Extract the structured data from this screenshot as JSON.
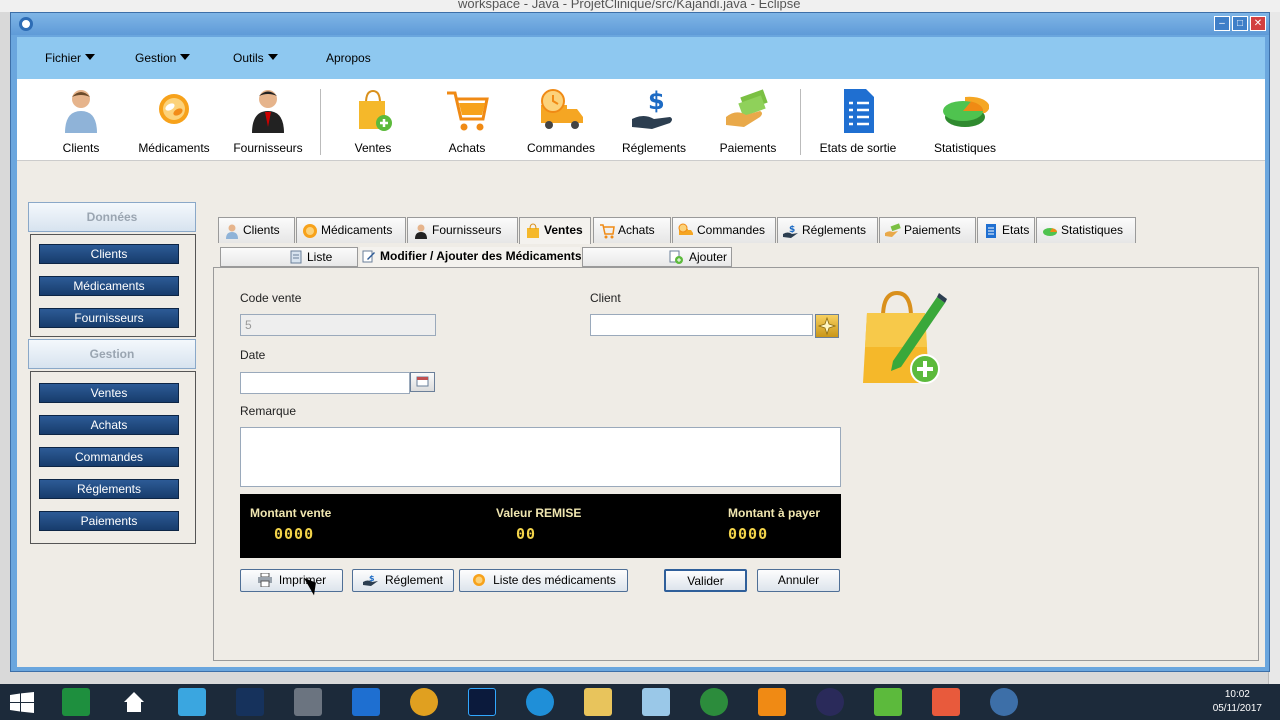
{
  "background": {
    "eclipse_title": "workspace - Java - ProjetClinique/src/Kajandi.java - Eclipse"
  },
  "menubar": {
    "items": [
      "Fichier",
      "Gestion",
      "Outils",
      "Apropos"
    ]
  },
  "toolbar": {
    "items": [
      {
        "label": "Clients",
        "icon": "client-person-icon"
      },
      {
        "label": "Médicaments",
        "icon": "medicine-icon"
      },
      {
        "label": "Fournisseurs",
        "icon": "supplier-person-icon"
      },
      {
        "label": "Ventes",
        "icon": "shopping-bag-icon"
      },
      {
        "label": "Achats",
        "icon": "cart-icon"
      },
      {
        "label": "Commandes",
        "icon": "delivery-truck-icon"
      },
      {
        "label": "Réglements",
        "icon": "dollar-hand-icon"
      },
      {
        "label": "Paiements",
        "icon": "money-hand-icon"
      },
      {
        "label": "Etats de sortie",
        "icon": "document-list-icon"
      },
      {
        "label": "Statistiques",
        "icon": "pie-chart-icon"
      }
    ]
  },
  "sidebar": {
    "sections": [
      {
        "title": "Données",
        "items": [
          "Clients",
          "Médicaments",
          "Fournisseurs"
        ]
      },
      {
        "title": "Gestion",
        "items": [
          "Ventes",
          "Achats",
          "Commandes",
          "Réglements",
          "Paiements"
        ]
      }
    ]
  },
  "tabs": [
    "Clients",
    "Médicaments",
    "Fournisseurs",
    "Ventes",
    "Achats",
    "Commandes",
    "Réglements",
    "Paiements",
    "Etats",
    "Statistiques"
  ],
  "active_tab": "Ventes",
  "subtabs": [
    "Liste",
    "Modifier / Ajouter des Médicaments",
    "Ajouter"
  ],
  "form": {
    "code_vente_label": "Code vente",
    "code_vente_value": "5",
    "client_label": "Client",
    "client_value": "",
    "date_label": "Date",
    "date_value": "",
    "remarque_label": "Remarque",
    "remarque_value": ""
  },
  "totals": {
    "montant_vente_label": "Montant vente",
    "montant_vente_value": "0000",
    "valeur_remise_label": "Valeur REMISE",
    "valeur_remise_value": "00",
    "montant_payer_label": "Montant à payer",
    "montant_payer_value": "0000"
  },
  "actions": {
    "imprimer": "Imprimer",
    "reglement": "Réglement",
    "liste_medicaments": "Liste des médicaments",
    "valider": "Valider",
    "annuler": "Annuler"
  },
  "taskbar": {
    "time": "10:02",
    "date": "05/11/2017"
  },
  "colors": {
    "menubar": "#8ec8f0",
    "side_button": "#1f477c",
    "totals_bg": "#000000",
    "totals_value": "#f2d34a"
  }
}
